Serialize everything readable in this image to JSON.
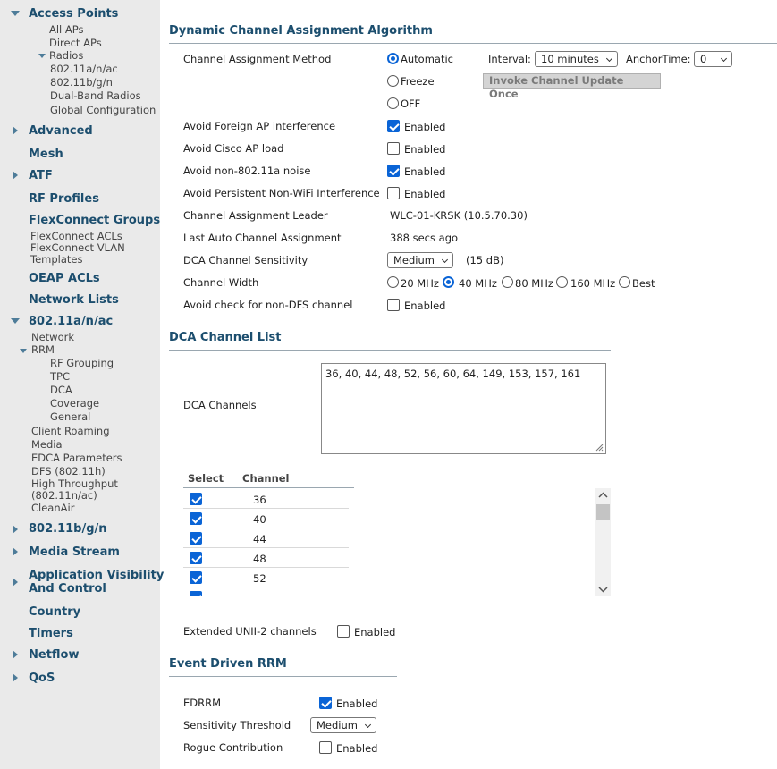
{
  "sidebar": {
    "access_points": "Access Points",
    "all_aps": "All APs",
    "direct_aps": "Direct APs",
    "radios": "Radios",
    "radio_a": "802.11a/n/ac",
    "radio_b": "802.11b/g/n",
    "dual_band": "Dual-Band Radios",
    "global_config": "Global Configuration",
    "advanced": "Advanced",
    "mesh": "Mesh",
    "atf": "ATF",
    "rf_profiles": "RF Profiles",
    "flexconnect_groups": "FlexConnect Groups",
    "flexconnect_acls": "FlexConnect ACLs",
    "flexconnect_vlan": "FlexConnect VLAN",
    "templates": "Templates",
    "oeap_acls": "OEAP ACLs",
    "network_lists": "Network Lists",
    "dot11a": "802.11a/n/ac",
    "network": "Network",
    "rrm": "RRM",
    "rf_grouping": "RF Grouping",
    "tpc": "TPC",
    "dca": "DCA",
    "coverage": "Coverage",
    "general": "General",
    "client_roaming": "Client Roaming",
    "media": "Media",
    "edca": "EDCA Parameters",
    "dfs": "DFS (802.11h)",
    "high_throughput": "High Throughput",
    "ht_sub": "(802.11n/ac)",
    "cleanair": "CleanAir",
    "dot11b": "802.11b/g/n",
    "media_stream": "Media Stream",
    "app_visibility_1": "Application Visibility",
    "app_visibility_2": "And Control",
    "country": "Country",
    "timers": "Timers",
    "netflow": "Netflow",
    "qos": "QoS"
  },
  "dca_section": {
    "title": "Dynamic Channel Assignment Algorithm",
    "method_label": "Channel Assignment Method",
    "opt_automatic": "Automatic",
    "opt_freeze": "Freeze",
    "opt_off": "OFF",
    "interval_label": "Interval:",
    "interval_value": "10 minutes",
    "anchor_label": "AnchorTime:",
    "anchor_value": "0",
    "invoke_button": "Invoke Channel Update Once",
    "avoid_foreign": "Avoid Foreign AP interference",
    "avoid_cisco": "Avoid Cisco AP load",
    "avoid_noise": "Avoid non-802.11a noise",
    "avoid_persistent": "Avoid Persistent Non-WiFi Interference",
    "enabled": "Enabled",
    "leader_label": "Channel Assignment Leader",
    "leader_value": "WLC-01-KRSK (10.5.70.30)",
    "last_auto_label": "Last Auto Channel Assignment",
    "last_auto_value": "388 secs ago",
    "sensitivity_label": "DCA Channel Sensitivity",
    "sensitivity_value": "Medium",
    "sensitivity_db": "(15 dB)",
    "width_label": "Channel Width",
    "width_20": "20 MHz",
    "width_40": "40 MHz",
    "width_80": "80 MHz",
    "width_160": "160 MHz",
    "width_best": "Best",
    "avoid_dfs": "Avoid check for non-DFS channel"
  },
  "channel_list": {
    "title": "DCA Channel List",
    "channels_label": "DCA Channels",
    "channels_value": "36, 40, 44, 48, 52, 56, 60, 64, 149, 153, 157, 161",
    "col_select": "Select",
    "col_channel": "Channel",
    "rows": [
      "36",
      "40",
      "44",
      "48",
      "52"
    ],
    "extended_label": "Extended UNII-2 channels",
    "enabled": "Enabled"
  },
  "edrrm": {
    "title": "Event Driven RRM",
    "edrrm_label": "EDRRM",
    "threshold_label": "Sensitivity Threshold",
    "threshold_value": "Medium",
    "rogue_label": "Rogue Contribution",
    "enabled": "Enabled"
  }
}
